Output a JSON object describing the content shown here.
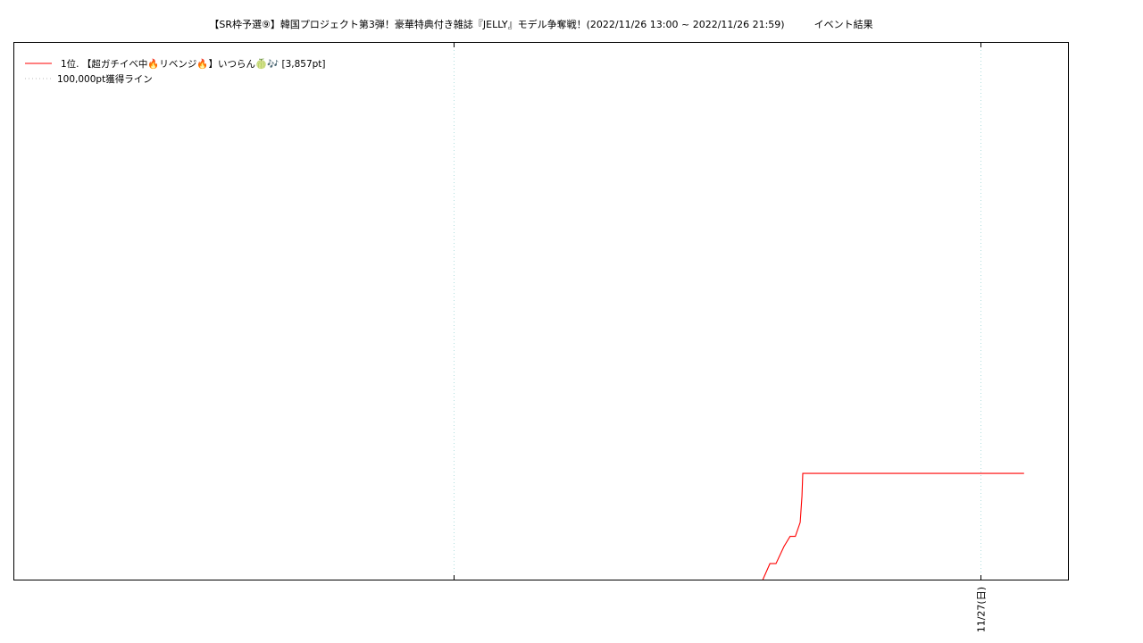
{
  "title": "【SR枠予選⑨】韓国プロジェクト第3弾！豪華特典付き雑誌『JELLY』モデル争奪戦！(2022/11/26 13:00 ~ 2022/11/26 21:59)　　　イベント結果",
  "chart_data": {
    "type": "line",
    "title": "【SR枠予選⑨】韓国プロジェクト第3弾！豪華特典付き雑誌『JELLY』モデル争奪戦！(2022/11/26 13:00 ~ 2022/11/26 21:59)　　　イベント結果",
    "xlabel": "",
    "ylabel": "",
    "x_ticks": [
      {
        "label": "",
        "hour": 12
      },
      {
        "label": "11/27(日)",
        "hour": 24
      }
    ],
    "xlim_hours": [
      2,
      26
    ],
    "ylim": [
      0,
      19500
    ],
    "grid": "x-dotted",
    "legend_position": "top-left",
    "series": [
      {
        "name": "1位. 【超ガチイベ中🔥リベンジ🔥】いつらん🍈🎶 [3,857pt]",
        "color": "#ff0000",
        "style": "solid",
        "points": [
          [
            19.05,
            0
          ],
          [
            19.21,
            580
          ],
          [
            19.35,
            580
          ],
          [
            19.53,
            1200
          ],
          [
            19.67,
            1570
          ],
          [
            19.79,
            1570
          ],
          [
            19.9,
            2080
          ],
          [
            19.94,
            3040
          ],
          [
            19.96,
            3857
          ],
          [
            25.0,
            3857
          ]
        ]
      },
      {
        "name": "100,000pt獲得ライン",
        "color": "#888888",
        "style": "dotted",
        "points": []
      }
    ]
  }
}
